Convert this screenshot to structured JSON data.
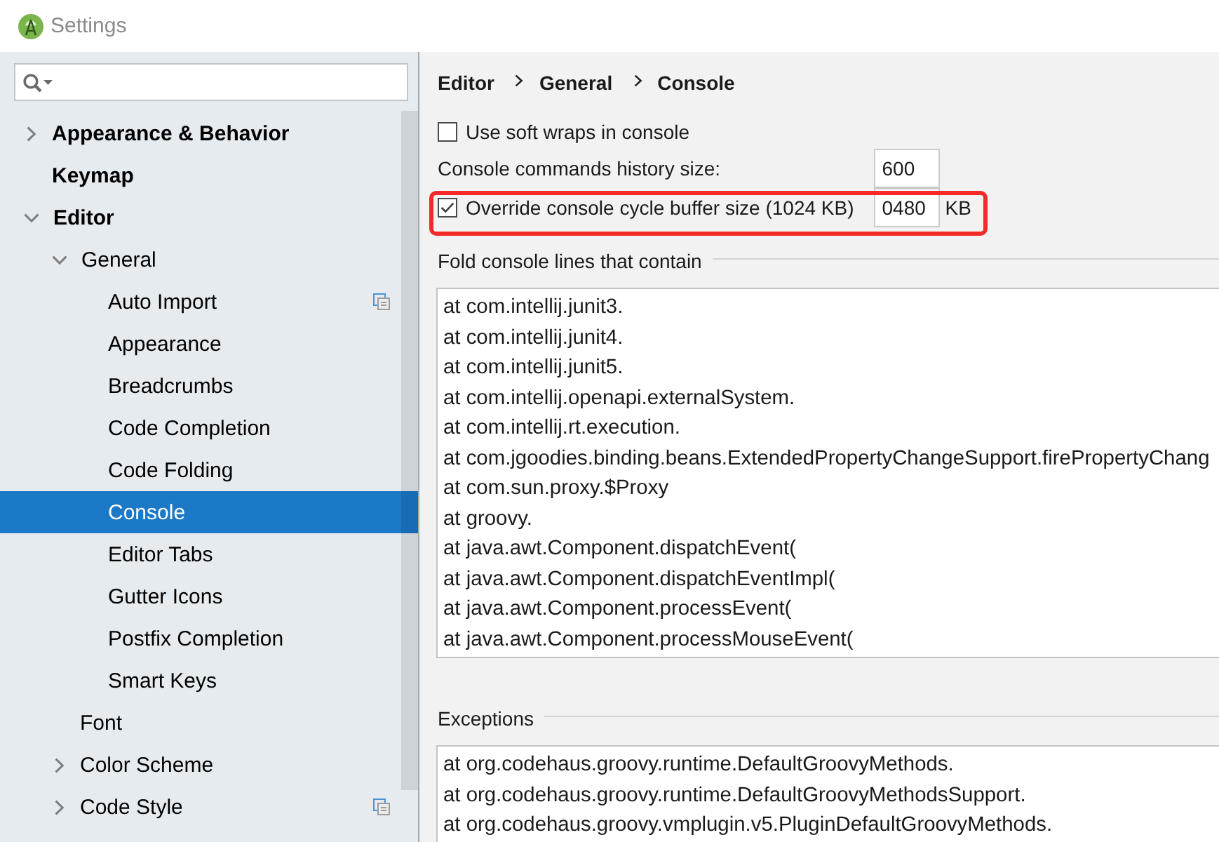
{
  "window": {
    "title": "Settings"
  },
  "sidebar": {
    "items": [
      {
        "label": "Appearance & Behavior",
        "kind": "branch",
        "expanded": false,
        "selected": false
      },
      {
        "label": "Keymap",
        "kind": "leaf",
        "selected": false
      },
      {
        "label": "Editor",
        "kind": "branch",
        "expanded": true,
        "selected": false,
        "children": [
          {
            "label": "General",
            "kind": "branch",
            "expanded": true,
            "selected": false,
            "children": [
              {
                "label": "Auto Import",
                "kind": "leaf",
                "selected": false,
                "project_level": true
              },
              {
                "label": "Appearance",
                "kind": "leaf",
                "selected": false
              },
              {
                "label": "Breadcrumbs",
                "kind": "leaf",
                "selected": false
              },
              {
                "label": "Code Completion",
                "kind": "leaf",
                "selected": false
              },
              {
                "label": "Code Folding",
                "kind": "leaf",
                "selected": false
              },
              {
                "label": "Console",
                "kind": "leaf",
                "selected": true
              },
              {
                "label": "Editor Tabs",
                "kind": "leaf",
                "selected": false
              },
              {
                "label": "Gutter Icons",
                "kind": "leaf",
                "selected": false
              },
              {
                "label": "Postfix Completion",
                "kind": "leaf",
                "selected": false
              },
              {
                "label": "Smart Keys",
                "kind": "leaf",
                "selected": false
              }
            ]
          },
          {
            "label": "Font",
            "kind": "leaf",
            "selected": false
          },
          {
            "label": "Color Scheme",
            "kind": "branch",
            "expanded": false,
            "selected": false
          },
          {
            "label": "Code Style",
            "kind": "branch",
            "expanded": false,
            "selected": false,
            "project_level": true
          }
        ]
      }
    ]
  },
  "breadcrumb": [
    "Editor",
    "General",
    "Console"
  ],
  "options": [
    {
      "kind": "checkbox",
      "label": "Use soft wraps in console",
      "checked": false
    },
    {
      "kind": "number",
      "label": "Console commands history size:",
      "value": "600"
    },
    {
      "kind": "limit",
      "label": "Override console cycle buffer size (1024 KB)",
      "checked": true,
      "value": "0480",
      "unit": "KB",
      "highlighted": true
    }
  ],
  "groups": [
    {
      "title": "Fold console lines that contain",
      "lines": [
        "at com.intellij.junit3.",
        "at com.intellij.junit4.",
        "at com.intellij.junit5.",
        "at com.intellij.openapi.externalSystem.",
        "at com.intellij.rt.execution.",
        "at com.jgoodies.binding.beans.ExtendedPropertyChangeSupport.firePropertyChang",
        "at com.sun.proxy.$Proxy",
        "at groovy.",
        "at java.awt.Component.dispatchEvent(",
        "at java.awt.Component.dispatchEventImpl(",
        "at java.awt.Component.processEvent(",
        "at java.awt.Component.processMouseEvent("
      ]
    },
    {
      "title": "Exceptions",
      "lines": [
        "at org.codehaus.groovy.runtime.DefaultGroovyMethods.",
        "at org.codehaus.groovy.runtime.DefaultGroovyMethodsSupport.",
        "at org.codehaus.groovy.vmplugin.v5.PluginDefaultGroovyMethods."
      ]
    }
  ]
}
